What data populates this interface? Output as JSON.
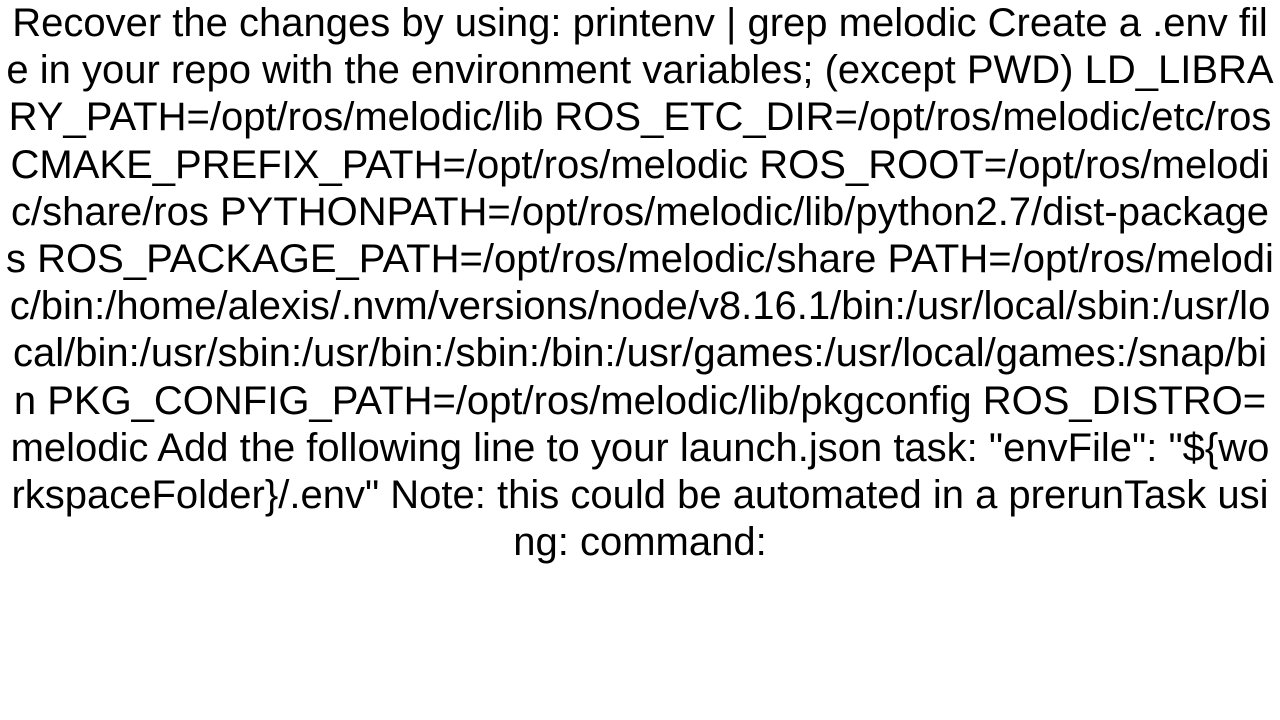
{
  "document": {
    "body": "Recover the changes by using: printenv | grep melodic Create a .env file in your repo with the environment variables; (except PWD) LD_LIBRARY_PATH=/opt/ros/melodic/lib ROS_ETC_DIR=/opt/ros/melodic/etc/ros CMAKE_PREFIX_PATH=/opt/ros/melodic ROS_ROOT=/opt/ros/melodic/share/ros PYTHONPATH=/opt/ros/melodic/lib/python2.7/dist-packages ROS_PACKAGE_PATH=/opt/ros/melodic/share PATH=/opt/ros/melodic/bin:/home/alexis/.nvm/versions/node/v8.16.1/bin:/usr/local/sbin:/usr/local/bin:/usr/sbin:/usr/bin:/sbin:/bin:/usr/games:/usr/local/games:/snap/bin PKG_CONFIG_PATH=/opt/ros/melodic/lib/pkgconfig ROS_DISTRO=melodic  Add the following line to your launch.json task: \"envFile\": \"${workspaceFolder}/.env\" Note: this could be automated in a prerunTask using: command:"
  }
}
